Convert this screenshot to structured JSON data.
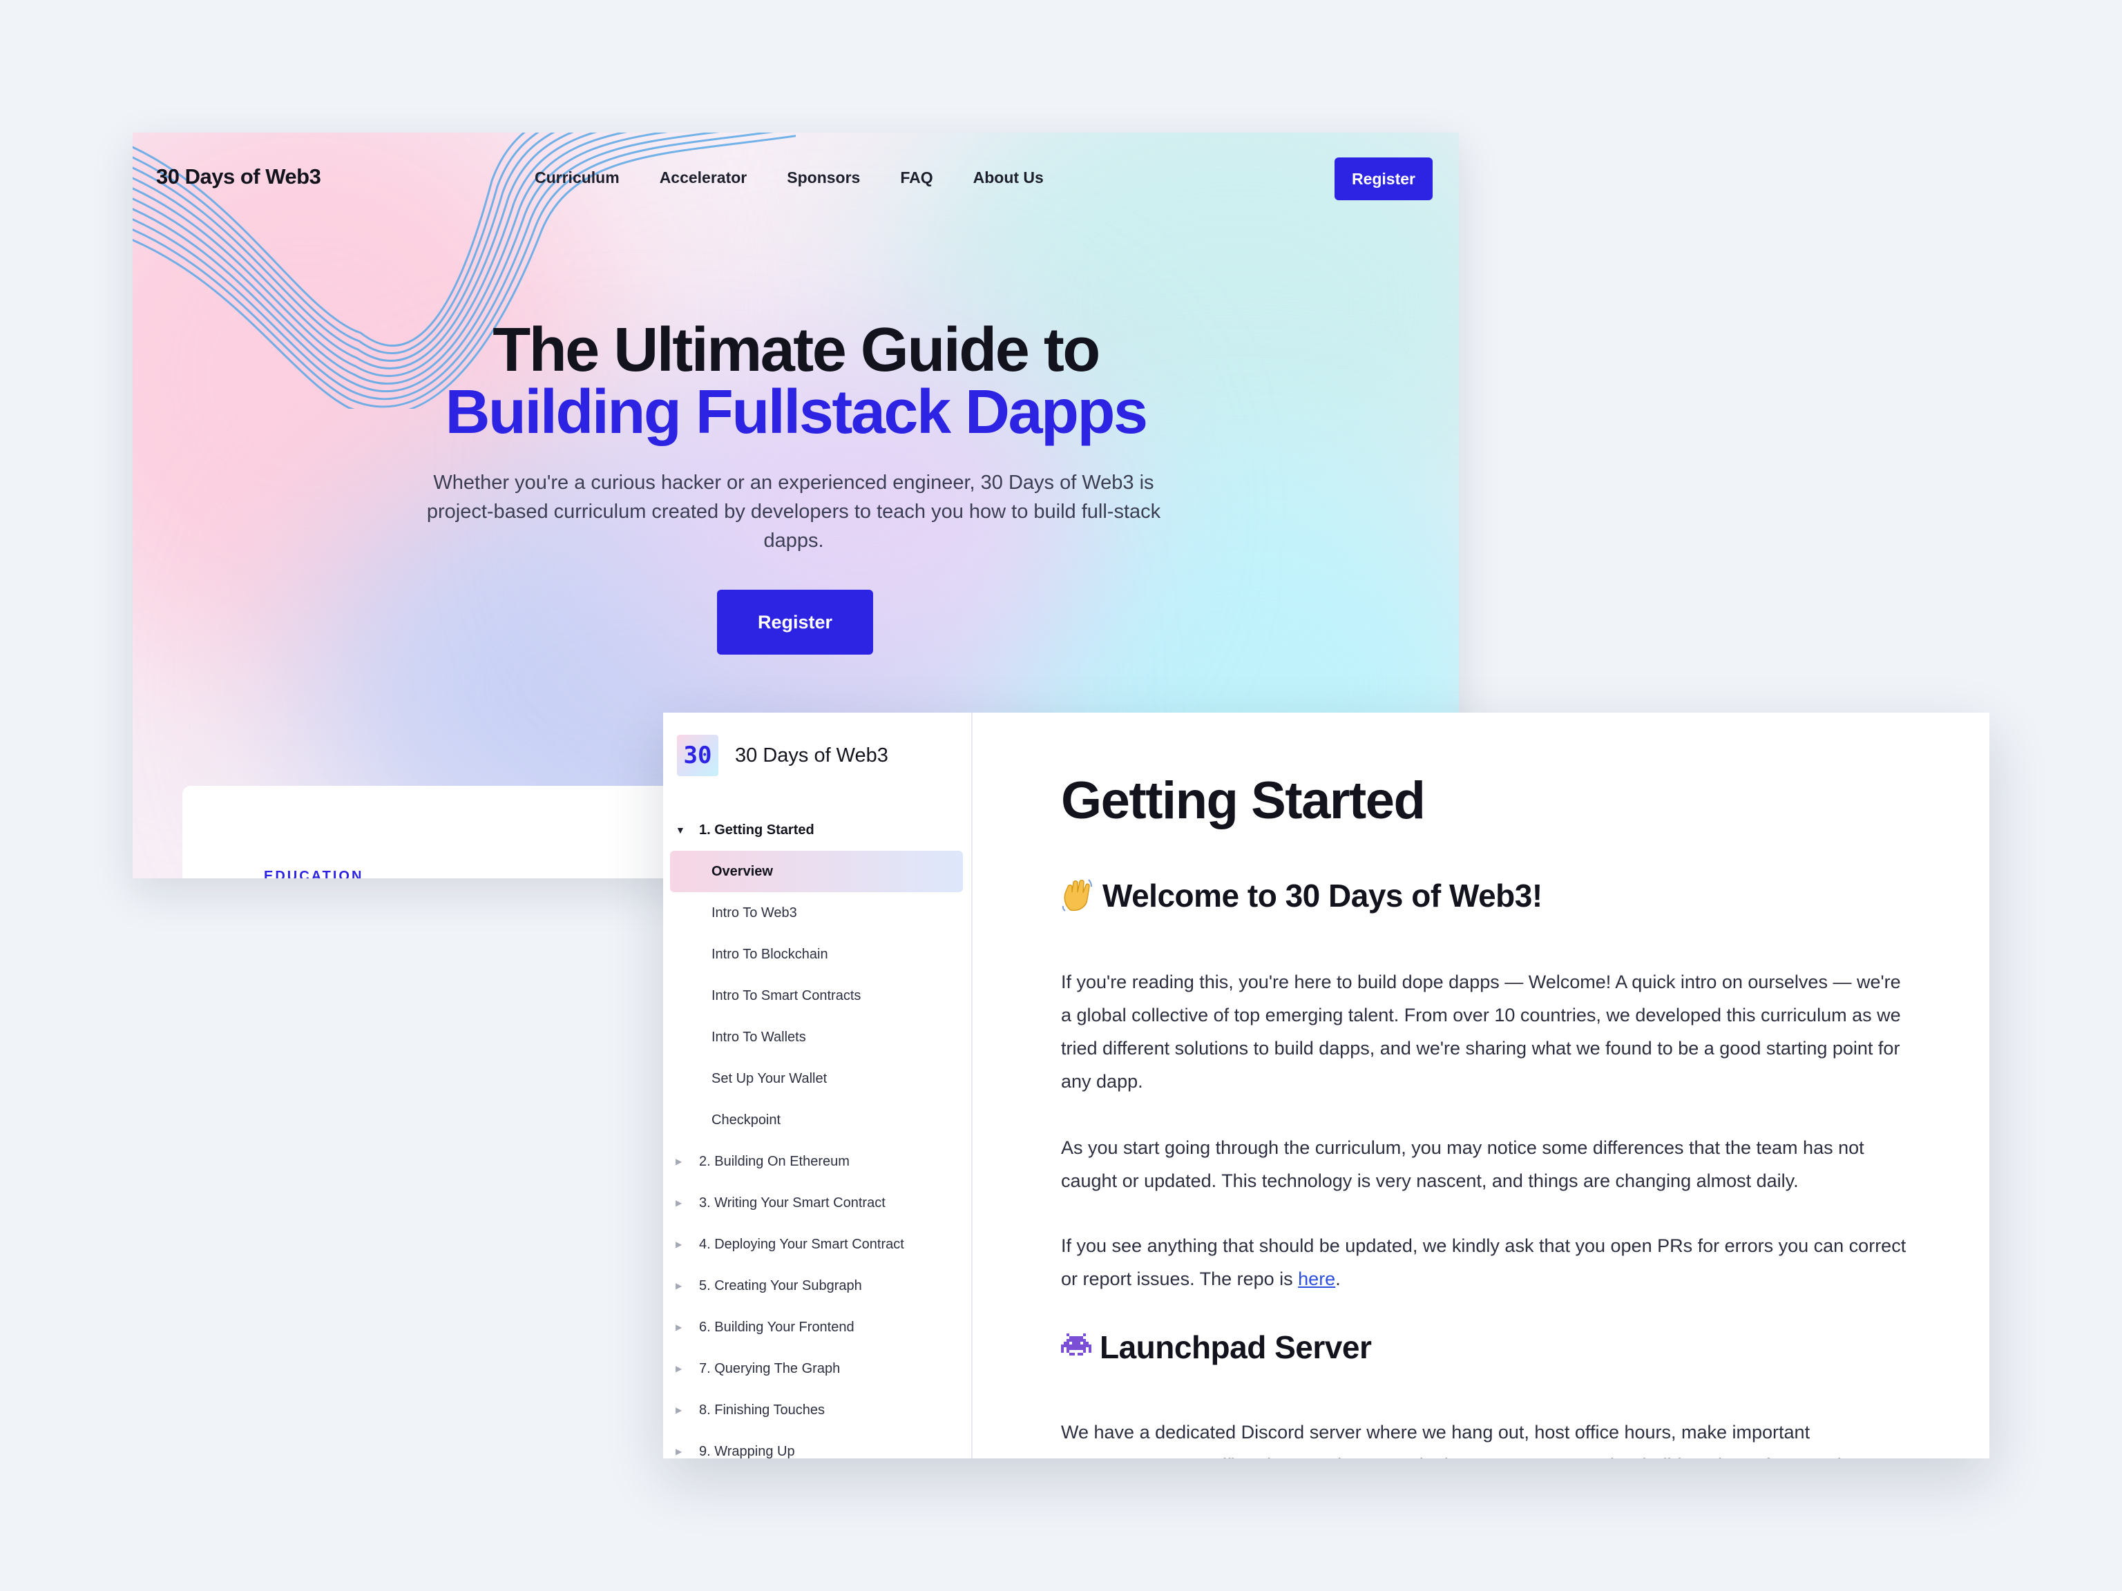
{
  "landing": {
    "brand": "30 Days of Web3",
    "nav": [
      "Curriculum",
      "Accelerator",
      "Sponsors",
      "FAQ",
      "About Us"
    ],
    "nav_cta": "Register",
    "hero_title_line1": "The Ultimate Guide to",
    "hero_title_line2": "Building Fullstack Dapps",
    "hero_subtitle": "Whether you're a curious hacker or an experienced engineer, 30 Days of Web3 is project-based curriculum created by developers to teach you how to build full-stack dapps.",
    "hero_cta": "Register",
    "section_label": "EDUCATION",
    "colors": {
      "accent": "#2d23e3",
      "ink": "#12131c"
    }
  },
  "docs": {
    "logo_text": "30",
    "brand": "30 Days of Web3",
    "sidebar": {
      "open_section": "1. Getting Started",
      "sub_items": [
        "Overview",
        "Intro To Web3",
        "Intro To Blockchain",
        "Intro To Smart Contracts",
        "Intro To Wallets",
        "Set Up Your Wallet",
        "Checkpoint"
      ],
      "active_item": "Overview",
      "sections": [
        "2. Building On Ethereum",
        "3. Writing Your Smart Contract",
        "4. Deploying Your Smart Contract",
        "5. Creating Your Subgraph",
        "6. Building Your Frontend",
        "7. Querying The Graph",
        "8. Finishing Touches",
        "9. Wrapping Up"
      ]
    },
    "title": "Getting Started",
    "welcome_heading": "Welcome to 30 Days of Web3!",
    "welcome_icon": "waving-hand-icon",
    "para1": "If you're reading this, you're here to build dope dapps — Welcome! A quick intro on ourselves — we're a global collective of top emerging talent. From over 10 countries, we developed this curriculum as we tried different solutions to build dapps, and we're sharing what we found to be a good starting point for any dapp.",
    "para2": "As you start going through the curriculum, you may notice some differences that the team has not caught or updated. This technology is very nascent, and things are changing almost daily.",
    "para3_before": "If you see anything that should be updated, we kindly ask that you open PRs for errors you can correct or report issues. The repo is ",
    "para3_link": "here",
    "para3_after": ".",
    "launchpad_heading": "Launchpad Server",
    "launchpad_icon": "alien-monster-icon",
    "para4": "We have a dedicated Discord server where we hang out, host office hours, make important announcements, raffle prizes, and more. Join the server to meet other builders, learn from each"
  }
}
